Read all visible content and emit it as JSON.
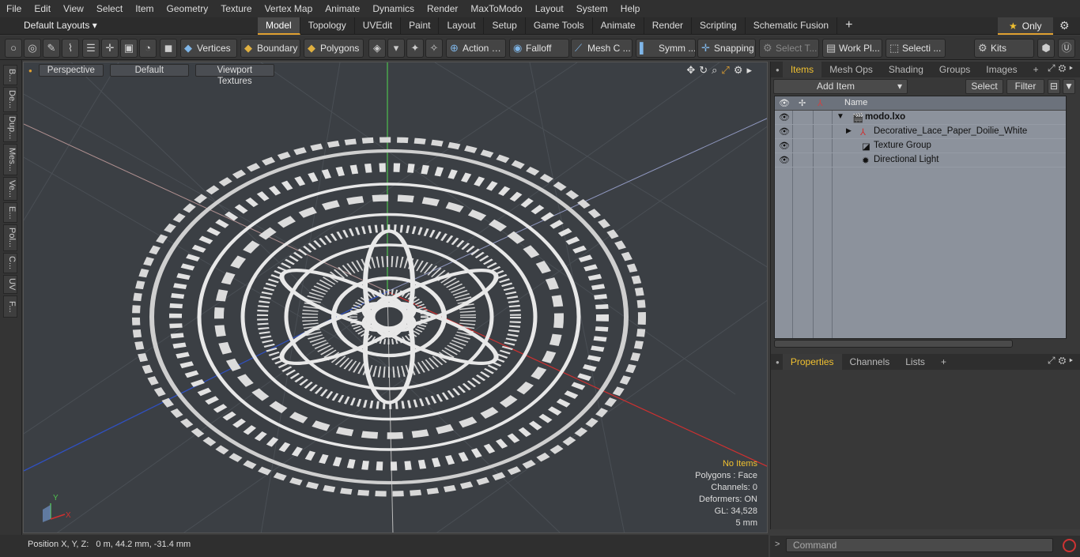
{
  "menu": [
    "File",
    "Edit",
    "View",
    "Select",
    "Item",
    "Geometry",
    "Texture",
    "Vertex Map",
    "Animate",
    "Dynamics",
    "Render",
    "MaxToModo",
    "Layout",
    "System",
    "Help"
  ],
  "layouts_label": "Default Layouts",
  "mode_tabs": [
    "Model",
    "Topology",
    "UVEdit",
    "Paint",
    "Layout",
    "Setup",
    "Game Tools",
    "Animate",
    "Render",
    "Scripting",
    "Schematic Fusion"
  ],
  "only_label": "Only",
  "toolbar": {
    "vertices": "Vertices",
    "boundary": "Boundary",
    "polygons": "Polygons",
    "action": "Action",
    "falloff": "Falloff",
    "mesh": "Mesh C ...",
    "symm": "Symm ...",
    "snapping": "Snapping",
    "select_t": "Select T...",
    "work_pl": "Work Pl...",
    "selecti": "Selecti ...",
    "kits": "Kits"
  },
  "left_tabs": [
    "B...",
    "De...",
    "Dup...",
    "Mes...",
    "Ve...",
    "E...",
    "Pol...",
    "C...",
    "UV",
    "F..."
  ],
  "viewport": {
    "perspective": "Perspective",
    "default": "Default",
    "textures": "Viewport Textures",
    "info": {
      "items": "No Items",
      "polygons": "Polygons : Face",
      "channels": "Channels: 0",
      "deformers": "Deformers: ON",
      "gl": "GL: 34,528",
      "scale": "5 mm"
    }
  },
  "status": "Position X, Y, Z:   0 m, 44.2 mm, -31.4 mm",
  "items_panel": {
    "tabs": [
      "Items",
      "Mesh Ops",
      "Shading",
      "Groups",
      "Images"
    ],
    "add_item": "Add Item",
    "select": "Select",
    "filter": "Filter",
    "name_header": "Name",
    "rows": [
      "modo.lxo",
      "Decorative_Lace_Paper_Doilie_White",
      "Texture Group",
      "Directional Light"
    ]
  },
  "properties_panel": {
    "tabs": [
      "Properties",
      "Channels",
      "Lists"
    ]
  },
  "command_placeholder": "Command"
}
